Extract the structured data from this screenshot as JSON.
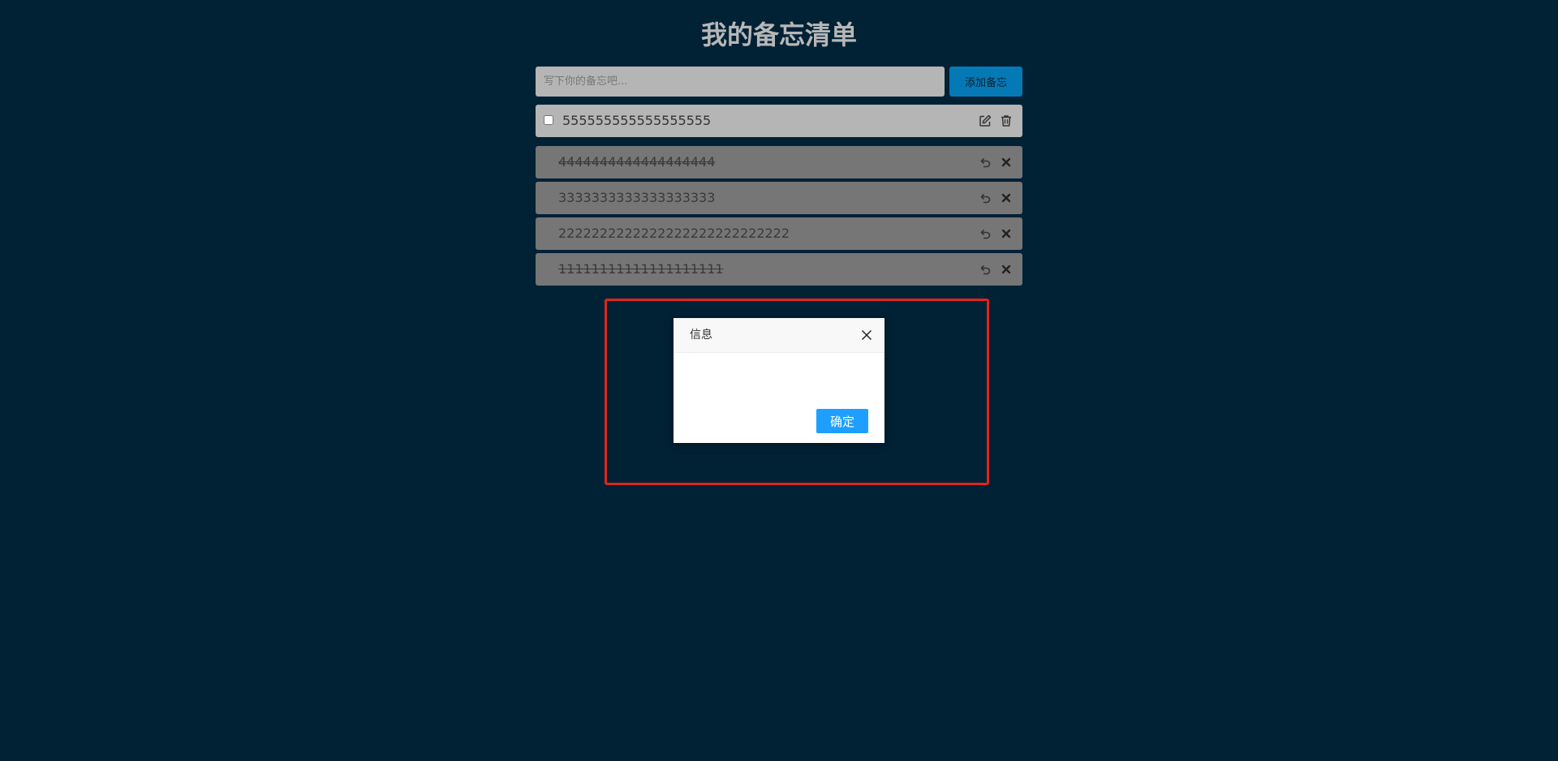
{
  "page": {
    "title": "我的备忘清单"
  },
  "add_form": {
    "placeholder": "写下你的备忘吧...",
    "value": "",
    "add_label": "添加备忘"
  },
  "todos": [
    {
      "text": "555555555555555555",
      "checked": false
    }
  ],
  "done": [
    {
      "text": "4444444444444444444",
      "struck": true
    },
    {
      "text": "3333333333333333333",
      "struck": false
    },
    {
      "text": "2222222222222222222222222222",
      "struck": false
    },
    {
      "text": "11111111111111111111",
      "struck": true
    }
  ],
  "dialog": {
    "title": "信息",
    "message": "",
    "confirm_label": "确定"
  },
  "colors": {
    "background": "#012135",
    "accent": "#0579b5",
    "confirm": "#1e9fff",
    "highlight_frame": "#e1251b"
  },
  "icons": {
    "todo_actions": [
      "edit-icon",
      "trash-icon"
    ],
    "done_actions": [
      "undo-icon",
      "close-icon"
    ],
    "dialog_close": "close-icon"
  }
}
